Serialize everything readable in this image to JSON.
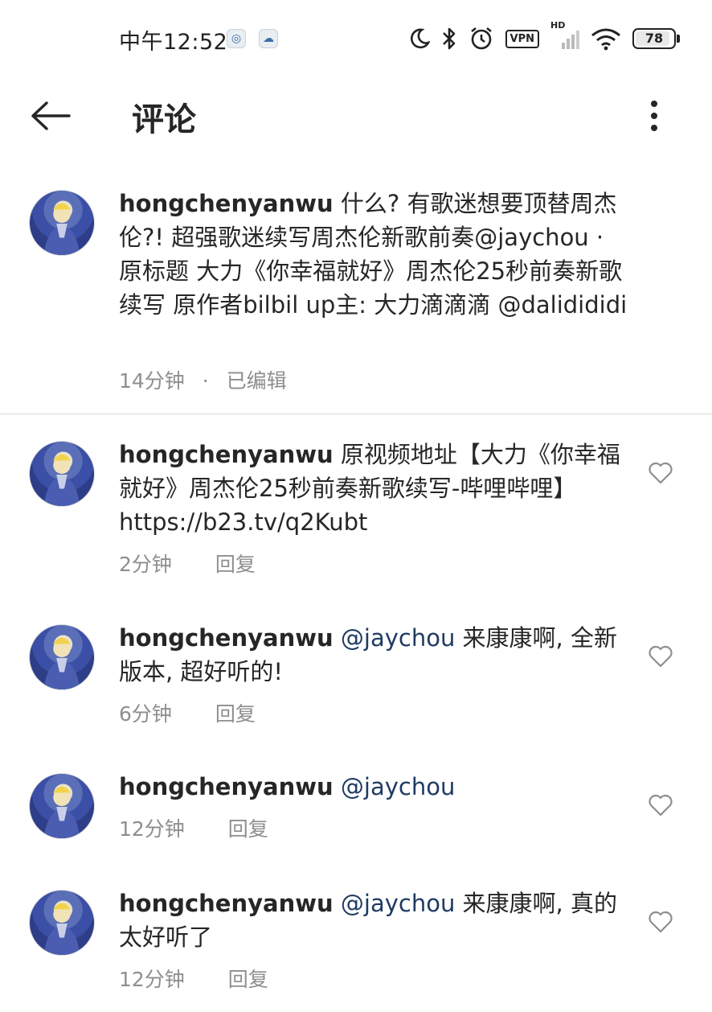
{
  "status_bar": {
    "time": "中午12:52",
    "battery": "78",
    "vpn": "VPN",
    "hd": "HD",
    "icons": [
      "moon-icon",
      "bluetooth-icon",
      "alarm-icon",
      "vpn-icon",
      "signal-icon",
      "wifi-icon",
      "battery-icon"
    ]
  },
  "header": {
    "title": "评论",
    "back_icon": "arrow-left-icon",
    "more_icon": "more-vertical-icon"
  },
  "caption": {
    "username": "hongchenyanwu",
    "text_1": " 什么? 有歌迷想要顶替周杰伦?! 超强歌迷续写周杰伦新歌前奏",
    "mention_1": "@jaychou",
    "text_2": " · 原标题 大力《你幸福就好》周杰伦25秒前奏新歌续写 原作者bilbil up主: 大力滴滴滴 ",
    "mention_2": "@dalidididi",
    "time": "14分钟",
    "separator": "·",
    "edited": "已编辑"
  },
  "comments": [
    {
      "username": "hongchenyanwu",
      "mention": "",
      "text": " 原视频地址【大力《你幸福就好》周杰伦25秒前奏新歌续写-哔哩哔哩】https://b23.tv/q2Kubt",
      "time": "2分钟",
      "reply": "回复"
    },
    {
      "username": "hongchenyanwu",
      "mention": " @jaychou",
      "text": " 来康康啊, 全新版本, 超好听的!",
      "time": "6分钟",
      "reply": "回复"
    },
    {
      "username": "hongchenyanwu",
      "mention": " @jaychou",
      "text": "",
      "time": "12分钟",
      "reply": "回复"
    },
    {
      "username": "hongchenyanwu",
      "mention": " @jaychou",
      "text": " 来康康啊, 真的太好听了",
      "time": "12分钟",
      "reply": "回复"
    }
  ],
  "colors": {
    "text": "#262626",
    "meta": "#8e8e8e",
    "mention": "#1f3b63",
    "divider": "#dbdbdb"
  }
}
